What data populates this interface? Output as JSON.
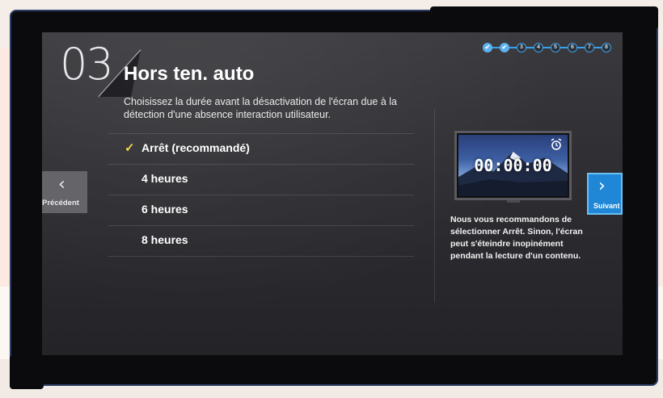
{
  "step": {
    "number": "03"
  },
  "header": {
    "title": "Hors ten. auto",
    "subtitle": "Choisissez la durée avant la désactivation de l'écran due à la détection d'une absence interaction utilisateur."
  },
  "options": [
    {
      "label": "Arrêt (recommandé)",
      "selected": true
    },
    {
      "label": "4 heures",
      "selected": false
    },
    {
      "label": "6 heures",
      "selected": false
    },
    {
      "label": "8 heures",
      "selected": false
    }
  ],
  "progress": {
    "steps": [
      "✔",
      "✔",
      "3",
      "4",
      "5",
      "6",
      "7",
      "8"
    ],
    "current": 3
  },
  "preview": {
    "time": "00:00:00",
    "icon": "alarm-clock-icon"
  },
  "description": "Nous vous recommandons de sélectionner Arrêt. Sinon, l'écran peut s'éteindre inopinément pendant la lecture d'un contenu.",
  "nav": {
    "prev_label": "Précédent",
    "prev_icon": "‹",
    "next_label": "Suivant",
    "next_icon": "›"
  },
  "colors": {
    "accent": "#1f87d6",
    "check": "#f2d24a"
  }
}
